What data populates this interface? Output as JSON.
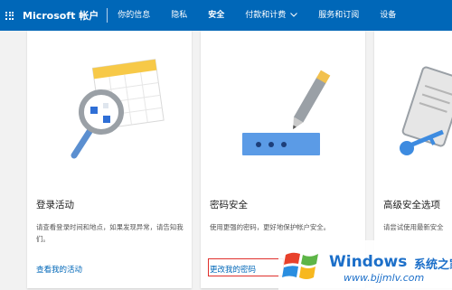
{
  "header": {
    "brand": "Microsoft 帐户",
    "nav": [
      {
        "label": "你的信息"
      },
      {
        "label": "隐私"
      },
      {
        "label": "安全"
      },
      {
        "label": "付款和计费"
      },
      {
        "label": "服务和订阅"
      },
      {
        "label": "设备"
      }
    ],
    "active_tab": "安全"
  },
  "cards": [
    {
      "title": "登录活动",
      "description": "请查看登录时间和地点，如果发现异常，请告知我们。",
      "link": "查看我的活动",
      "icon": "magnifier-calendar-icon"
    },
    {
      "title": "密码安全",
      "description": "使用更强的密码，更好地保护帐户安全。",
      "link": "更改我的密码",
      "icon": "password-pen-icon"
    },
    {
      "title": "高级安全选项",
      "description": "请尝试使用最新安全",
      "icon": "key-phone-icon"
    }
  ],
  "watermark": {
    "brand": "Windows",
    "tagline": "系统之家",
    "url": "www.bjjmlv.com"
  },
  "colors": {
    "topbar": "#0067b8",
    "link": "#0067b8",
    "highlight": "#e0302c",
    "background": "#f2f2f2"
  }
}
